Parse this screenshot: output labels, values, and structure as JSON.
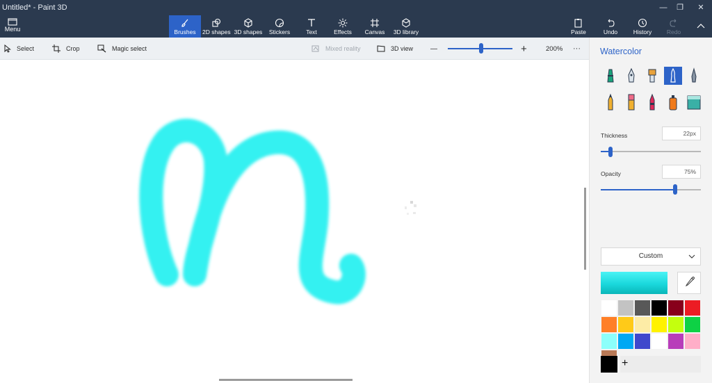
{
  "window": {
    "title": "Untitled* - Paint 3D",
    "minimize": "—",
    "maximize": "❐",
    "close": "✕"
  },
  "ribbon": {
    "menu_label": "Menu",
    "tools": [
      {
        "label": "Brushes",
        "icon": "brush-icon",
        "active": true
      },
      {
        "label": "2D shapes",
        "icon": "shapes-2d-icon"
      },
      {
        "label": "3D shapes",
        "icon": "cube-icon"
      },
      {
        "label": "Stickers",
        "icon": "sticker-icon"
      },
      {
        "label": "Text",
        "icon": "text-icon"
      },
      {
        "label": "Effects",
        "icon": "sun-icon"
      },
      {
        "label": "Canvas",
        "icon": "canvas-icon"
      },
      {
        "label": "3D library",
        "icon": "library-icon"
      }
    ],
    "right_tools": [
      {
        "label": "Paste",
        "icon": "paste-icon"
      },
      {
        "label": "Undo",
        "icon": "undo-icon"
      },
      {
        "label": "History",
        "icon": "history-icon"
      },
      {
        "label": "Redo",
        "icon": "redo-icon",
        "disabled": true
      }
    ]
  },
  "subbar": {
    "select": "Select",
    "crop": "Crop",
    "magic_select": "Magic select",
    "mixed_reality": "Mixed reality",
    "view_3d": "3D view",
    "zoom_minus": "—",
    "zoom_plus": "+",
    "zoom_level": "200%",
    "more": "···"
  },
  "panel": {
    "title": "Watercolor",
    "brushes": [
      {
        "name": "marker",
        "color": "#1aa37a"
      },
      {
        "name": "calligraphy-pen",
        "color": "#2d3d4f"
      },
      {
        "name": "oil-brush",
        "color": "#e8a23b"
      },
      {
        "name": "watercolor",
        "color": "#ffffff",
        "selected": true
      },
      {
        "name": "pixel-pen",
        "color": "#6f7a88"
      },
      {
        "name": "pencil",
        "color": "#f0b030"
      },
      {
        "name": "eraser",
        "color": "#f06a86"
      },
      {
        "name": "crayon",
        "color": "#e02a5a"
      },
      {
        "name": "spray-can",
        "color": "#f07a1a"
      },
      {
        "name": "fill",
        "color": "#3ab0a6"
      }
    ],
    "thickness_label": "Thickness",
    "thickness_value": "22px",
    "thickness_fraction": 0.1,
    "opacity_label": "Opacity",
    "opacity_value": "75%",
    "opacity_fraction": 0.74,
    "custom_label": "Custom",
    "palette": [
      "#ffffff",
      "#c3c3c3",
      "#585858",
      "#000000",
      "#88001b",
      "#ec1c24",
      "#ff7f27",
      "#ffca18",
      "#fdeca6",
      "#fff200",
      "#c4ff0e",
      "#0ed145",
      "#8cfffb",
      "#00a8f3",
      "#3f48cc",
      "#ffffff",
      "#b83dba",
      "#ffaec8"
    ],
    "palette_extra": [
      "#b97a57"
    ],
    "current_color": "#000000",
    "add_label": "+"
  },
  "stroke_color": "#20f0f0"
}
